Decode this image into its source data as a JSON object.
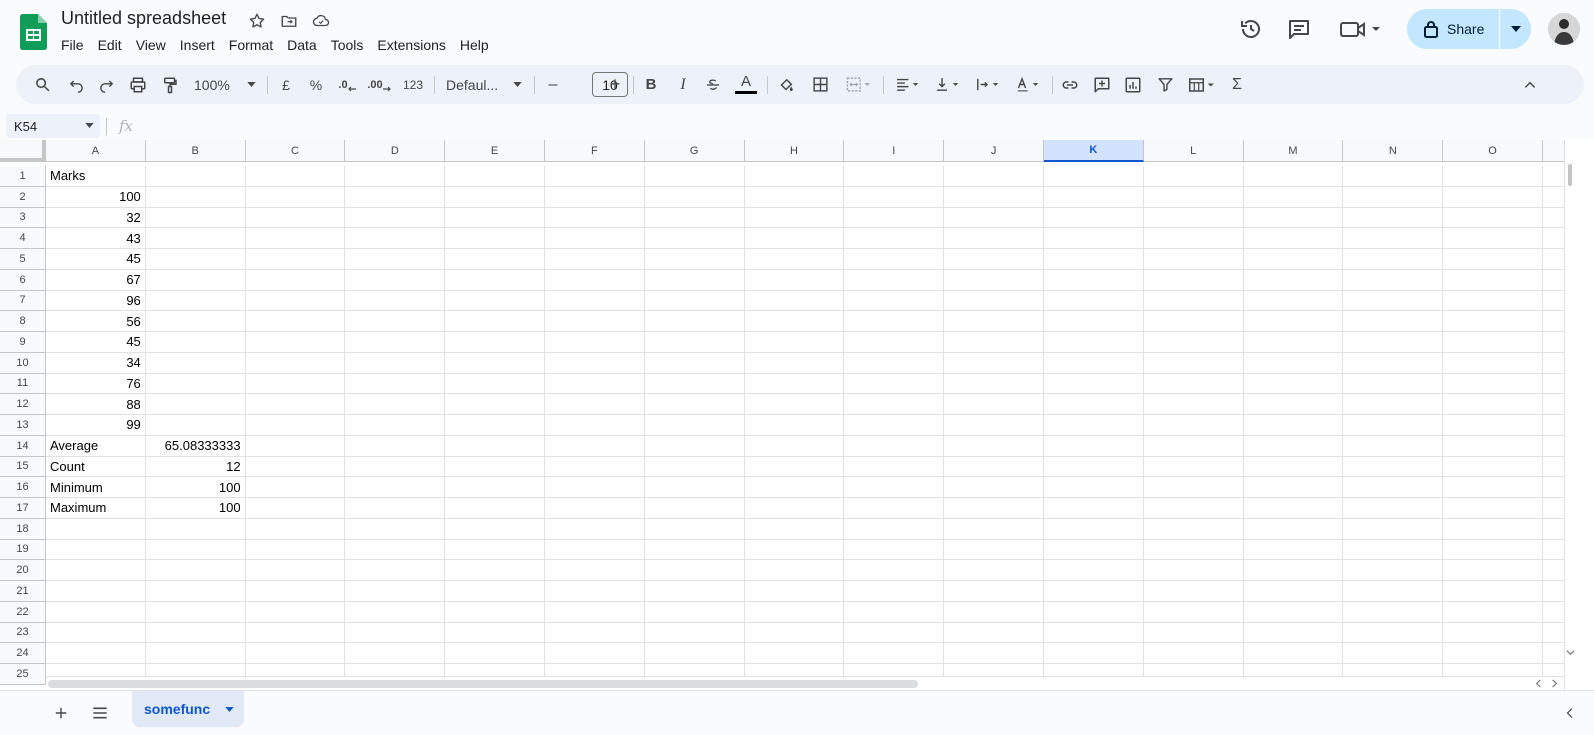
{
  "app": {
    "title": "Untitled spreadsheet",
    "menu": [
      "File",
      "Edit",
      "View",
      "Insert",
      "Format",
      "Data",
      "Tools",
      "Extensions",
      "Help"
    ],
    "share_label": "Share"
  },
  "toolbar": {
    "zoom": "100%",
    "currency": "£",
    "percent": "%",
    "dec_decrease": ".0",
    "dec_increase": ".00",
    "number_format": "123",
    "font": "Defaul...",
    "font_size": "10",
    "minus": "–",
    "plus": "+",
    "bold": "B",
    "italic": "I",
    "strike": "S",
    "text_color": "A",
    "sum": "Σ"
  },
  "formula_bar": {
    "name_box": "K54",
    "fx": "fx",
    "content": ""
  },
  "grid": {
    "columns": [
      "A",
      "B",
      "C",
      "D",
      "E",
      "F",
      "G",
      "H",
      "I",
      "J",
      "K",
      "L",
      "M",
      "N",
      "O"
    ],
    "selected_column": "K",
    "rows": [
      "1",
      "2",
      "3",
      "4",
      "5",
      "6",
      "7",
      "8",
      "9",
      "10",
      "11",
      "12",
      "13",
      "14",
      "15",
      "16",
      "17",
      "18",
      "19",
      "20",
      "21",
      "22",
      "23",
      "24",
      "25"
    ],
    "cells": [
      {
        "ref": "A1",
        "value": "Marks",
        "num": false
      },
      {
        "ref": "A2",
        "value": "100",
        "num": true
      },
      {
        "ref": "A3",
        "value": "32",
        "num": true
      },
      {
        "ref": "A4",
        "value": "43",
        "num": true
      },
      {
        "ref": "A5",
        "value": "45",
        "num": true
      },
      {
        "ref": "A6",
        "value": "67",
        "num": true
      },
      {
        "ref": "A7",
        "value": "96",
        "num": true
      },
      {
        "ref": "A8",
        "value": "56",
        "num": true
      },
      {
        "ref": "A9",
        "value": "45",
        "num": true
      },
      {
        "ref": "A10",
        "value": "34",
        "num": true
      },
      {
        "ref": "A11",
        "value": "76",
        "num": true
      },
      {
        "ref": "A12",
        "value": "88",
        "num": true
      },
      {
        "ref": "A13",
        "value": "99",
        "num": true
      },
      {
        "ref": "A14",
        "value": "Average",
        "num": false
      },
      {
        "ref": "B14",
        "value": "65.08333333",
        "num": true
      },
      {
        "ref": "A15",
        "value": "Count",
        "num": false
      },
      {
        "ref": "B15",
        "value": "12",
        "num": true
      },
      {
        "ref": "A16",
        "value": "Minimum",
        "num": false
      },
      {
        "ref": "B16",
        "value": "100",
        "num": true
      },
      {
        "ref": "A17",
        "value": "Maximum",
        "num": false
      },
      {
        "ref": "B17",
        "value": "100",
        "num": true
      }
    ]
  },
  "sheets": {
    "active": "somefunc"
  },
  "colors": {
    "accent": "#0b57d0",
    "share_bg": "#c2e7ff",
    "toolbar_bg": "#edf2fa",
    "sheets_green": "#0f9d58"
  }
}
